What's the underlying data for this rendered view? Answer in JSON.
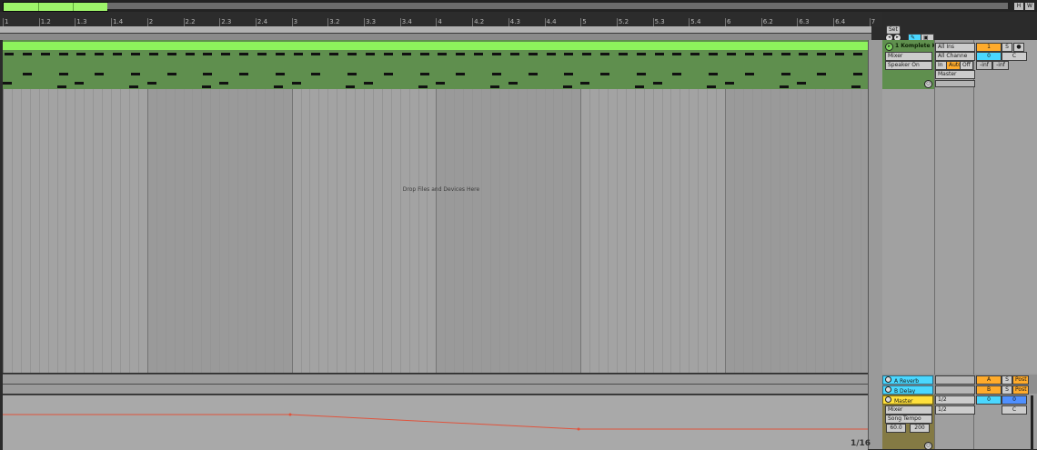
{
  "window": {
    "h_label": "H",
    "w_label": "W"
  },
  "ruler": {
    "labels": [
      "1",
      "1.2",
      "1.3",
      "1.4",
      "2",
      "2.2",
      "2.3",
      "2.4",
      "3",
      "3.2",
      "3.3",
      "3.4",
      "4",
      "4.2",
      "4.3",
      "4.4",
      "5",
      "5.2",
      "5.3",
      "5.4",
      "6",
      "6.2",
      "6.3",
      "6.4",
      "7"
    ]
  },
  "arrangement": {
    "drop_hint": "Drop Files and Devices Here"
  },
  "controls": {
    "set_label": "Set"
  },
  "track1": {
    "name": "1 Komplete K",
    "input_type": "All Ins",
    "input_channel": "All Channe",
    "device": "Mixer",
    "param": "Speaker On",
    "monitor_in": "In",
    "monitor_auto": "Auto",
    "monitor_off": "Off",
    "output": "Master",
    "number": "1",
    "solo": "S",
    "vol": "0",
    "pan": "C",
    "level_left": "-inf",
    "level_right": "-inf"
  },
  "returns": [
    {
      "name": "A Reverb",
      "letter": "A",
      "solo": "S",
      "post": "Post"
    },
    {
      "name": "B Delay",
      "letter": "B",
      "solo": "S",
      "post": "Post"
    }
  ],
  "master": {
    "name": "Master",
    "device": "Mixer",
    "param": "Song Tempo",
    "tempo_min": "60.0",
    "tempo_max": "200",
    "cue_out": "1/2",
    "master_out": "1/2",
    "vol": "0",
    "pan": "C",
    "vol2": "0"
  },
  "quantization": "1/16",
  "colors": {
    "clip_green": "#8df35c",
    "track_green": "#5f8f4e",
    "automation_red": "#e0533c",
    "return_cyan": "#4ad7ff",
    "master_yellow": "#ffe03c",
    "accent_orange": "#ffab2b"
  }
}
